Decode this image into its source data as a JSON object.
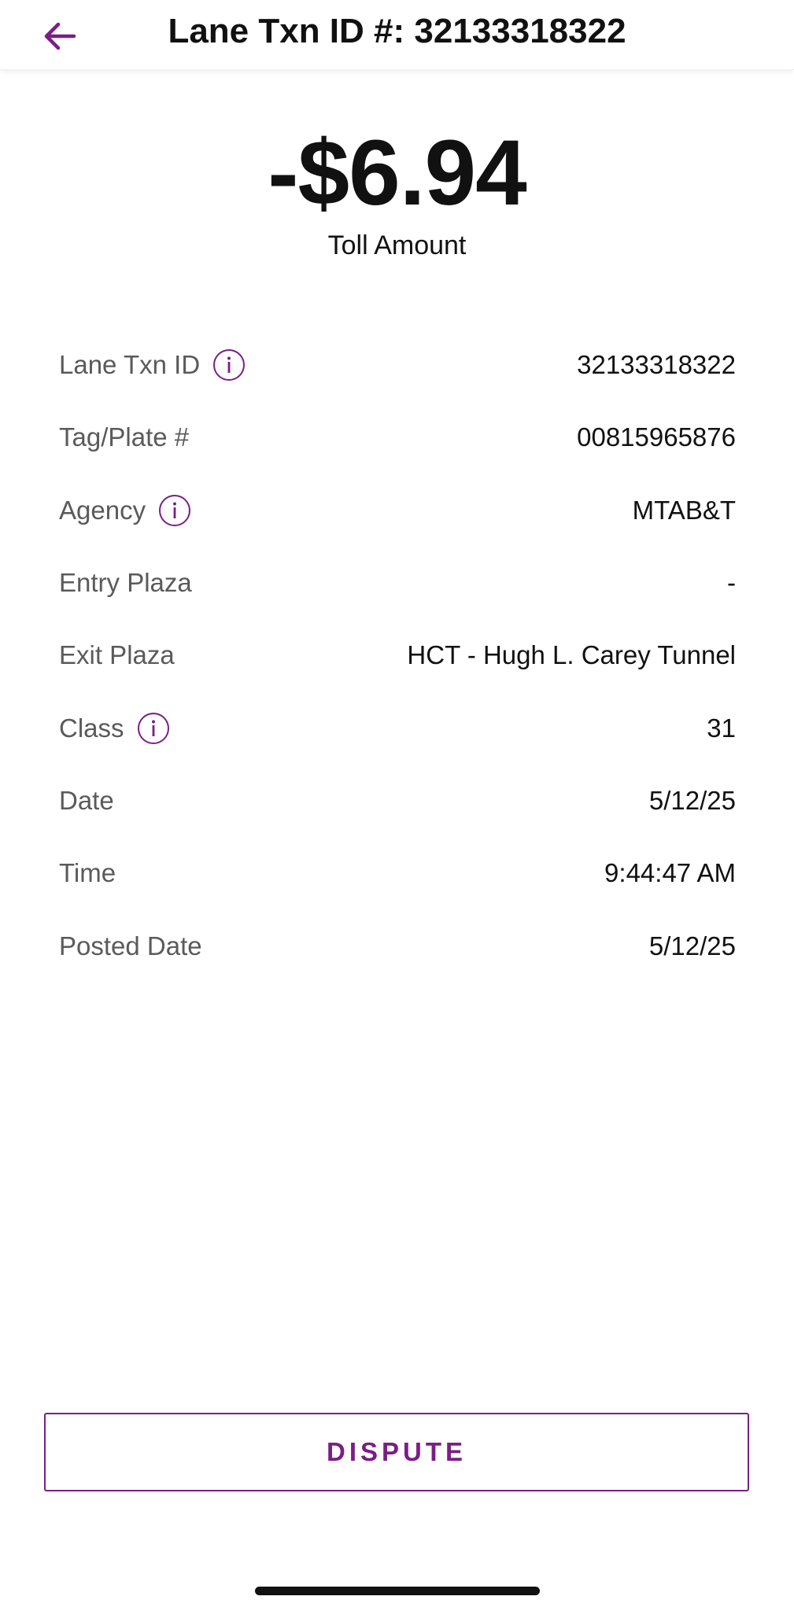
{
  "header": {
    "title": "Lane Txn ID #: 32133318322",
    "back_icon": "arrow-left-icon"
  },
  "amount": {
    "value": "-$6.94",
    "label": "Toll Amount"
  },
  "details": [
    {
      "label": "Lane Txn ID",
      "value": "32133318322",
      "has_info": true
    },
    {
      "label": "Tag/Plate #",
      "value": "00815965876",
      "has_info": false
    },
    {
      "label": "Agency",
      "value": "MTAB&T",
      "has_info": true
    },
    {
      "label": "Entry Plaza",
      "value": "-",
      "has_info": false
    },
    {
      "label": "Exit Plaza",
      "value": "HCT - Hugh L. Carey Tunnel",
      "has_info": false
    },
    {
      "label": "Class",
      "value": "31",
      "has_info": true
    },
    {
      "label": "Date",
      "value": "5/12/25",
      "has_info": false
    },
    {
      "label": "Time",
      "value": "9:44:47 AM",
      "has_info": false
    },
    {
      "label": "Posted Date",
      "value": "5/12/25",
      "has_info": false
    }
  ],
  "actions": {
    "dispute_label": "DISPUTE"
  },
  "colors": {
    "accent": "#7a1e87",
    "label_text": "#5a5a5a",
    "value_text": "#111111"
  }
}
